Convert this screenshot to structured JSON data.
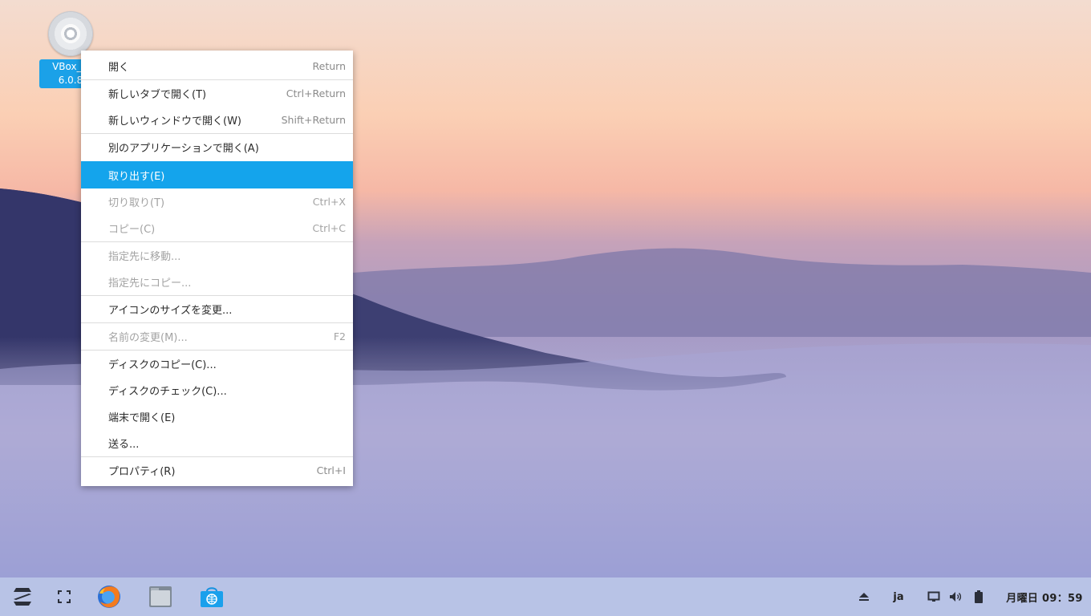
{
  "desktop": {
    "icon": {
      "name": "disc-icon",
      "label_line1": "VBox_G",
      "label_line2": "6.0.8"
    }
  },
  "context_menu": {
    "items": [
      {
        "label": "開く",
        "accel": "Return",
        "enabled": true,
        "active": false
      },
      {
        "label": "新しいタブで開く(T)",
        "accel": "Ctrl+Return",
        "enabled": true,
        "active": false
      },
      {
        "label": "新しいウィンドウで開く(W)",
        "accel": "Shift+Return",
        "enabled": true,
        "active": false
      },
      {
        "label": "別のアプリケーションで開く(A)",
        "accel": "",
        "enabled": true,
        "active": false
      },
      {
        "label": "取り出す(E)",
        "accel": "",
        "enabled": true,
        "active": true
      },
      {
        "label": "切り取り(T)",
        "accel": "Ctrl+X",
        "enabled": false,
        "active": false
      },
      {
        "label": "コピー(C)",
        "accel": "Ctrl+C",
        "enabled": false,
        "active": false
      },
      {
        "label": "指定先に移動...",
        "accel": "",
        "enabled": false,
        "active": false
      },
      {
        "label": "指定先にコピー...",
        "accel": "",
        "enabled": false,
        "active": false
      },
      {
        "label": "アイコンのサイズを変更...",
        "accel": "",
        "enabled": true,
        "active": false
      },
      {
        "label": "名前の変更(M)...",
        "accel": "F2",
        "enabled": false,
        "active": false
      },
      {
        "label": "ディスクのコピー(C)...",
        "accel": "",
        "enabled": true,
        "active": false
      },
      {
        "label": "ディスクのチェック(C)...",
        "accel": "",
        "enabled": true,
        "active": false
      },
      {
        "label": "端末で開く(E)",
        "accel": "",
        "enabled": true,
        "active": false
      },
      {
        "label": "送る...",
        "accel": "",
        "enabled": true,
        "active": false
      },
      {
        "label": "プロパティ(R)",
        "accel": "Ctrl+I",
        "enabled": true,
        "active": false
      }
    ]
  },
  "taskbar": {
    "launchers": [
      "zorin-menu-icon",
      "workspaces-icon",
      "firefox-icon",
      "files-icon",
      "software-store-icon"
    ],
    "tray": {
      "eject_icon": "eject-icon",
      "keyboard_layout": "ja",
      "display_icon": "display-icon",
      "volume_icon": "volume-icon",
      "battery_icon": "battery-icon"
    },
    "clock": "月曜日 09：59"
  },
  "colors": {
    "highlight": "#14a4ec",
    "taskbar": "#b8c3e6",
    "menu_bg": "#ffffff"
  }
}
